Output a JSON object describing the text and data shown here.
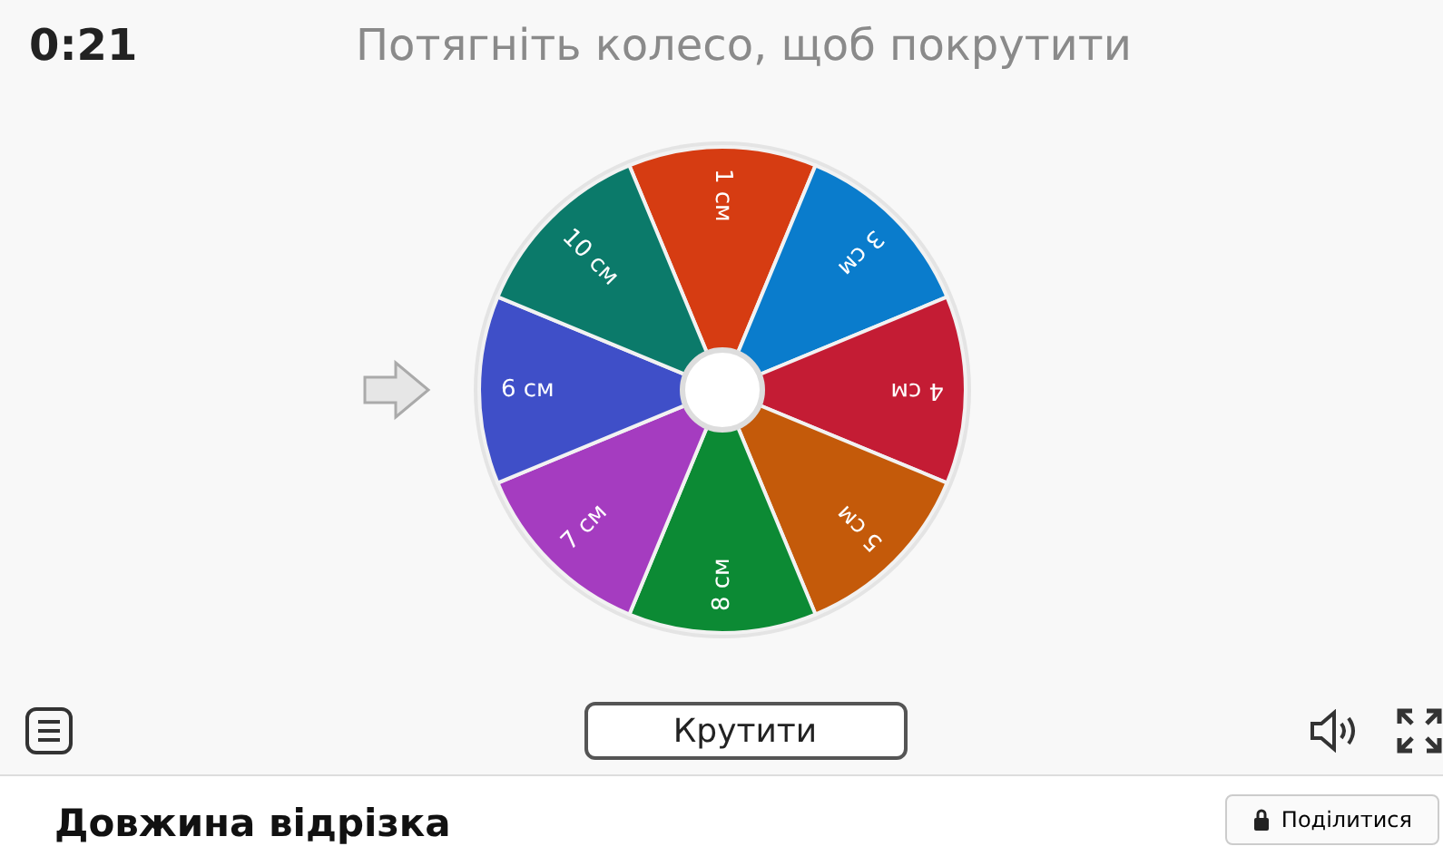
{
  "timer": "0:21",
  "instruction": "Потягніть колесо, щоб покрутити",
  "wheel": {
    "segments": [
      {
        "label": "1 см",
        "color": "#d63c12"
      },
      {
        "label": "3 см",
        "color": "#0a7ccc"
      },
      {
        "label": "4 см",
        "color": "#c41c34"
      },
      {
        "label": "5 см",
        "color": "#c45a0a"
      },
      {
        "label": "8 см",
        "color": "#0c8a34"
      },
      {
        "label": "7 см",
        "color": "#a53cc0"
      },
      {
        "label": "6 см",
        "color": "#3f4fc8"
      },
      {
        "label": "10 см",
        "color": "#0b7a6a"
      }
    ]
  },
  "spin_button": "Крутити",
  "activity_title": "Довжина відрізка",
  "share_button": "Поділитися"
}
